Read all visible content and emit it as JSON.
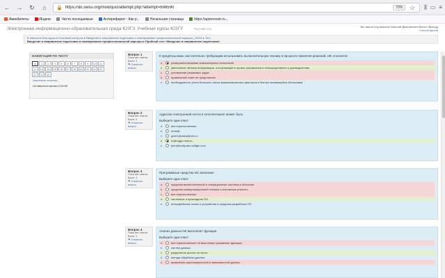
{
  "browser": {
    "url": "https://do.swsu.org/mod/quiz/attempt.php?attempt=698590",
    "zoom": "70%"
  },
  "bookmarks": [
    {
      "label": "Авиабилеты",
      "color": "#e2572c"
    },
    {
      "label": "Яндекс",
      "color": "#ff0000"
    },
    {
      "label": "Часто посещаемые",
      "color": "#888888"
    },
    {
      "label": "Антиреферат - Как р...",
      "color": "#2c6ed6"
    },
    {
      "label": "Начальная страница",
      "color": "#888888"
    },
    {
      "label": "https://aprioreostr.ru...",
      "color": "#4a8a2a"
    }
  ],
  "site": {
    "title": "Электронная информационно-образовательная среда ЮЗГУ. Учебные курсы ЮЗГУ",
    "lang": "Русский (ru)",
    "user_line": "Вы зашли под именем Николай Дмитриевич Масло (Выход)",
    "courses": "Список курсов"
  },
  "breadcrumb": {
    "line1": "В начало  ▸  Мои курсы  ▸  Итоговый контроль  ▸  Введение в направление подготовки и планирование профессиональной карьеры_10202  ▸  Тест",
    "line2": "Введение в направление подготовки и планирование профессиональной карьеры  ▸  Пробный тест «Введение в направление подготовки»"
  },
  "quiz_nav": {
    "title": "НАВИГАЦИЯ ПО ТЕСТУ",
    "pages": [
      "1",
      "2",
      "3",
      "4",
      "5",
      "6",
      "7",
      "8",
      "9",
      "10",
      "11",
      "12",
      "13",
      "14",
      "15",
      "16",
      "17",
      "18",
      "19",
      "20",
      "21",
      "22",
      "23",
      "24",
      "25"
    ],
    "current": "1",
    "finish": "Закончить попытку...",
    "time_left": "Оставшееся время 0:26:59"
  },
  "questions": [
    {
      "no_label": "Вопрос 1",
      "state": "Пока нет ответа",
      "marks": "Балл: 1",
      "flag": "Отметить вопрос",
      "text": "К предпосылкам, настоятельно требующим использовать вычислительную технику в процессе принятия решений, НЕ относится:",
      "prompt": "",
      "answers": [
        {
          "letter": "a.",
          "text": "усовершенствование компьютерных технологий",
          "selected": true,
          "style": "wrong"
        },
        {
          "letter": "b.",
          "text": "увеличение объема информации, поступающей в органы управления и непосредственно к руководителям",
          "selected": false,
          "style": "right"
        },
        {
          "letter": "c.",
          "text": "усложнение решаемых задач",
          "selected": false,
          "style": "wrong"
        },
        {
          "letter": "d.",
          "text": "правильный ответ не представлен",
          "selected": false,
          "style": "wrong"
        },
        {
          "letter": "e.",
          "text": "необходимость учета большого числа взаимосвязанных факторов и быстро меняющейся обстановки",
          "selected": false,
          "style": "plain"
        }
      ]
    },
    {
      "no_label": "Вопрос 2",
      "state": "Пока нет ответа",
      "marks": "Балл: 1",
      "flag": "Отметить вопрос",
      "text": "Адресом электронной почты в сети Интернет может быть",
      "prompt": "Выберите один ответ:",
      "answers": [
        {
          "letter": "a.",
          "text": "все перечисленные",
          "selected": false,
          "style": "plain"
        },
        {
          "letter": "b.",
          "text": "mmk@",
          "selected": false,
          "style": "plain"
        },
        {
          "letter": "c.",
          "text": "gvs01@www@ulm.ru",
          "selected": false,
          "style": "plain"
        },
        {
          "letter": "d.",
          "text": "m@mgpu.msk.ru",
          "selected": true,
          "style": "right"
        },
        {
          "letter": "e.",
          "text": "john@sctdy.abc.uidfgfx.com",
          "selected": false,
          "style": "plain"
        }
      ]
    },
    {
      "no_label": "Вопрос 3",
      "state": "Пока нет ответа",
      "marks": "Балл: 1",
      "flag": "Отметить вопрос",
      "text": "Программные средства ИС включают",
      "prompt": "Выберите один ответ:",
      "answers": [
        {
          "letter": "a.",
          "text": "средства вычислительной и операционные системы и оболочки",
          "selected": false,
          "style": "wrong"
        },
        {
          "letter": "b.",
          "text": "средства коммуникационной техники и системные утилиты",
          "selected": false,
          "style": "wrong"
        },
        {
          "letter": "c.",
          "text": "все перечисленные",
          "selected": false,
          "style": "wrong"
        },
        {
          "letter": "d.",
          "text": "системное и прикладное ПО",
          "selected": false,
          "style": "right"
        },
        {
          "letter": "e.",
          "text": "интерфейсные платы и устройства и средства разработки ПО",
          "selected": false,
          "style": "plain"
        }
      ]
    },
    {
      "no_label": "Вопрос 4",
      "state": "Пока нет ответа",
      "marks": "Балл: 1",
      "flag": "Отметить вопрос",
      "text": "Анализ данных НЕ выполняет функции",
      "prompt": "Выберите один ответ:",
      "answers": [
        {
          "letter": "a.",
          "text": "все перечисленные не выполняют указанные функции",
          "selected": false,
          "style": "wrong"
        },
        {
          "letter": "b.",
          "text": "систем данных",
          "selected": false,
          "style": "plain"
        },
        {
          "letter": "c.",
          "text": "разделения целого на части",
          "selected": false,
          "style": "right"
        },
        {
          "letter": "d.",
          "text": "метода обработки данных",
          "selected": false,
          "style": "plain"
        },
        {
          "letter": "e.",
          "text": "выявления закономерностей и зависимостей данных",
          "selected": false,
          "style": "wrong"
        }
      ]
    }
  ]
}
